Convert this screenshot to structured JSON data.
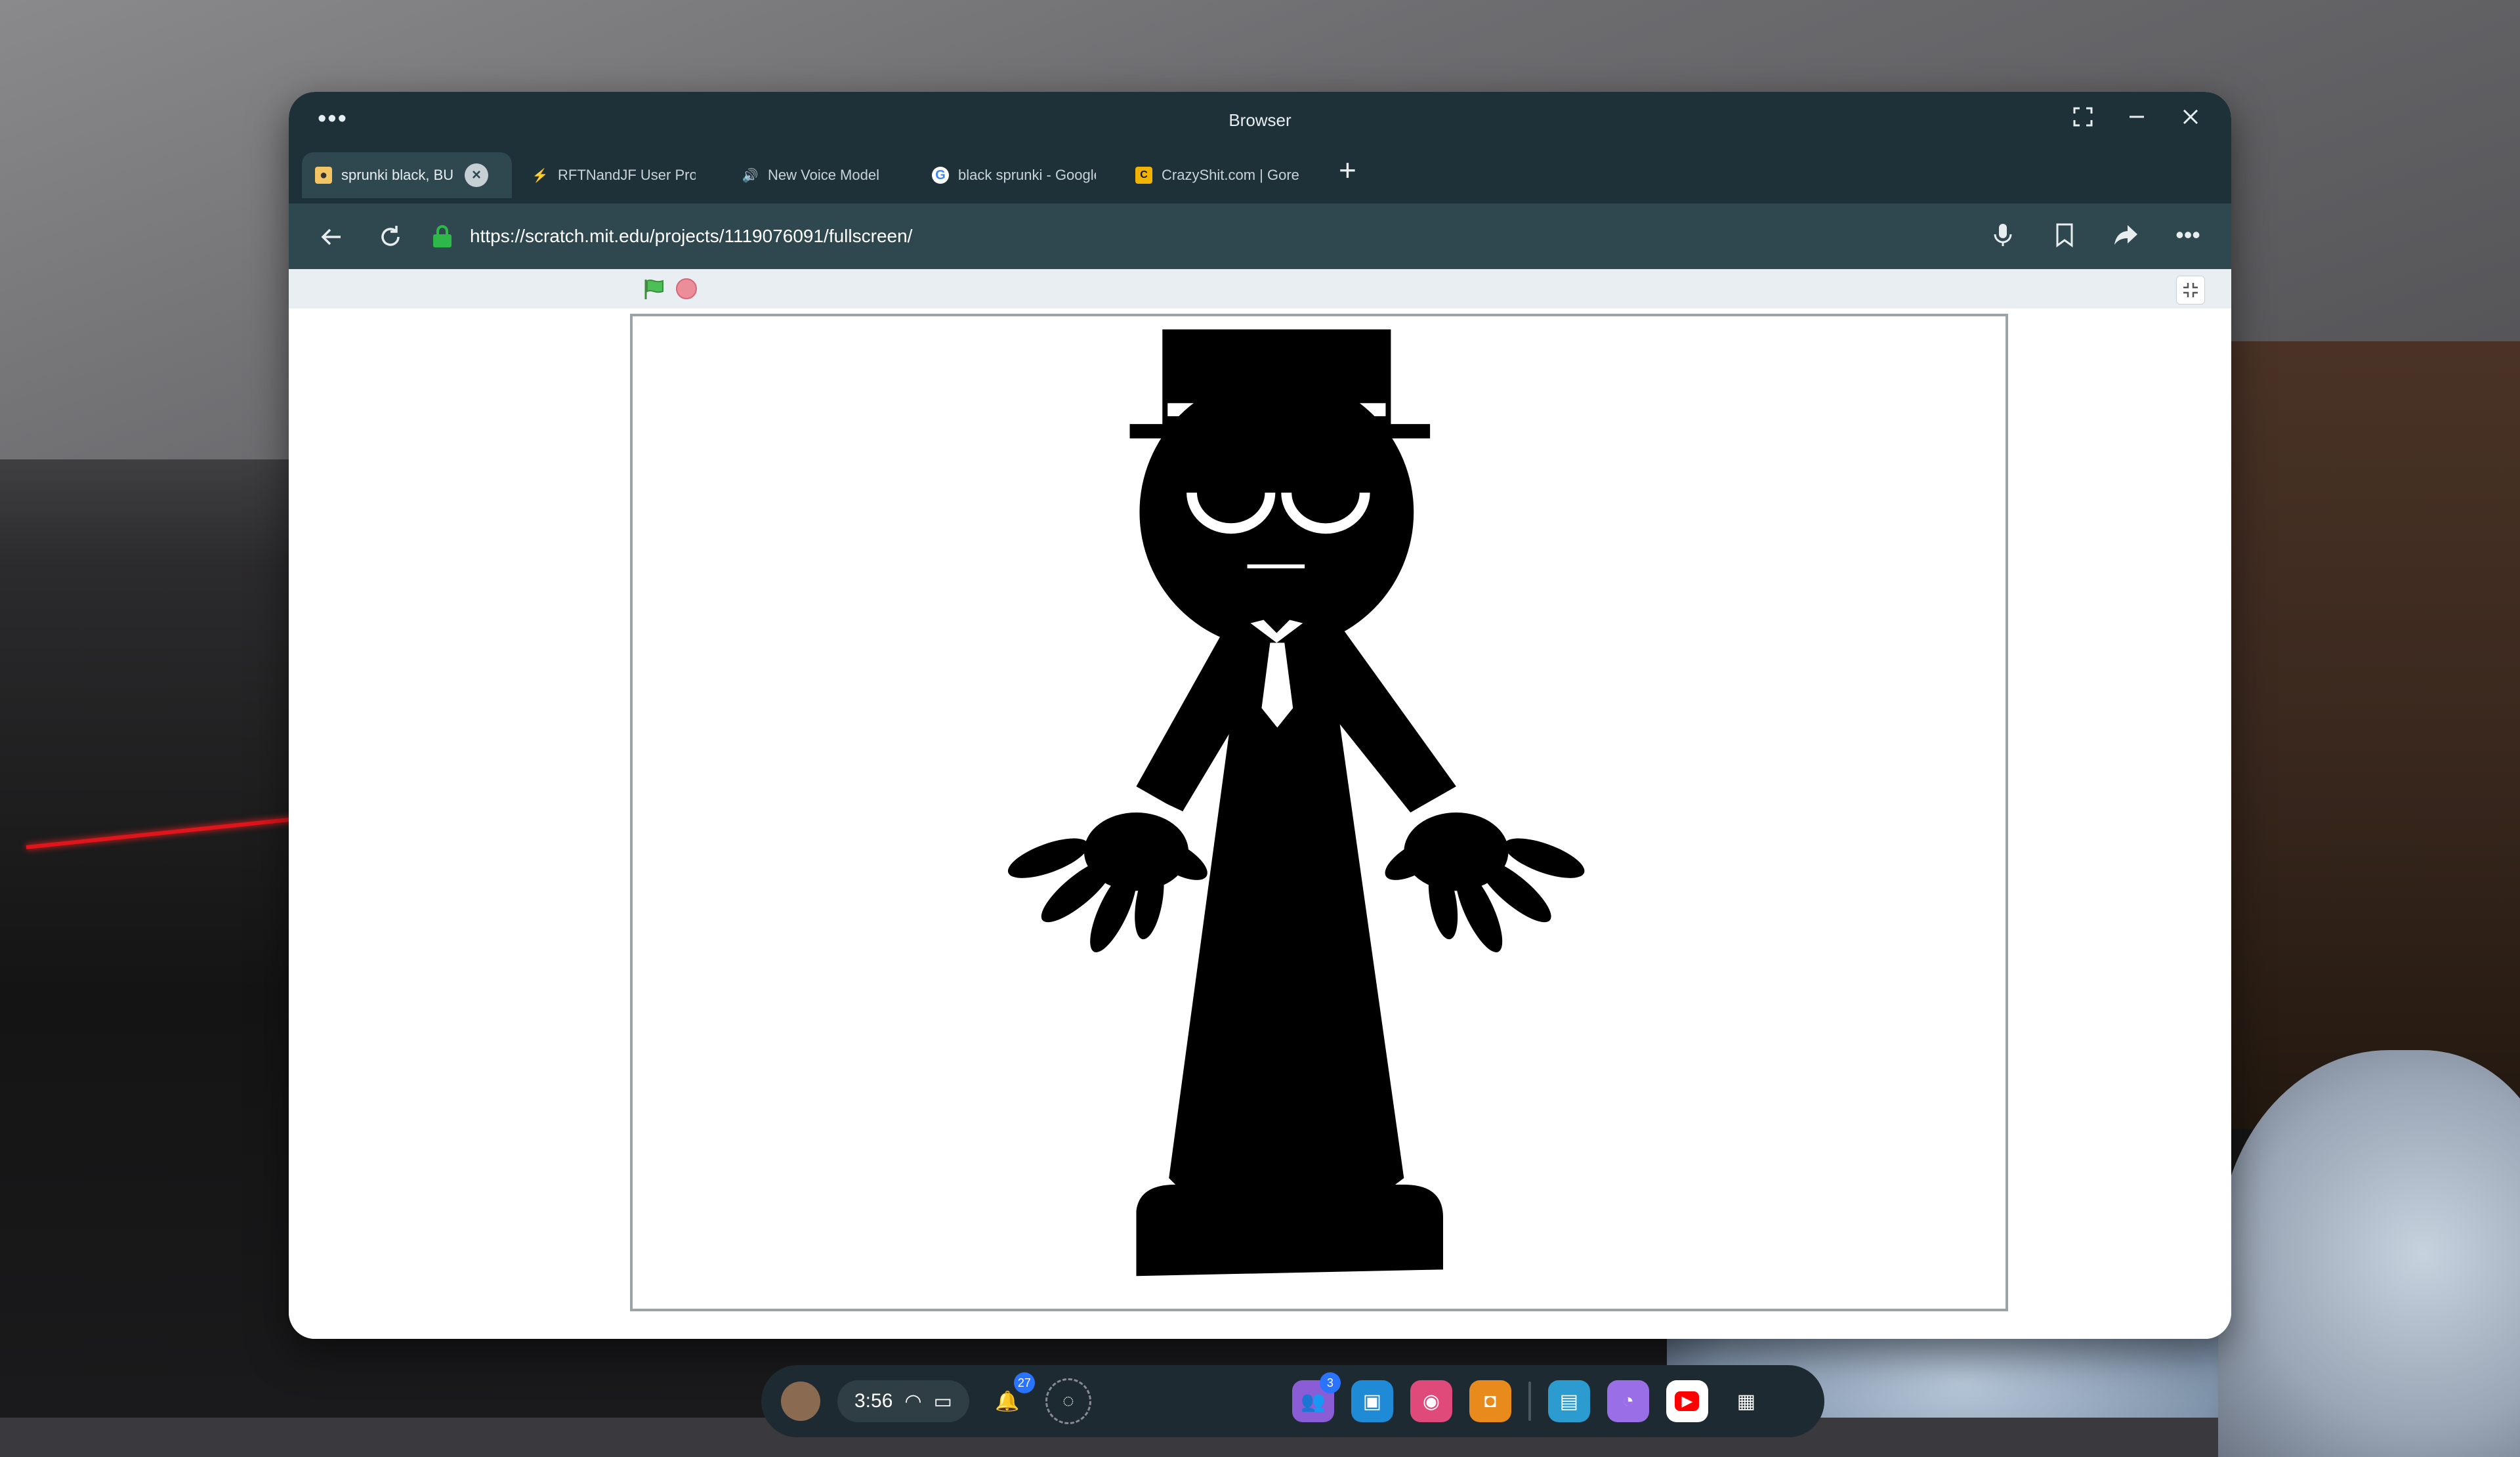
{
  "window": {
    "title": "Browser",
    "menu_glyph": "•••"
  },
  "tabs": [
    {
      "label": "sprunki black, BU",
      "favicon": "scratch-cat-icon",
      "active": true
    },
    {
      "label": "RFTNandJF User Profile",
      "favicon": "rftn-icon",
      "active": false
    },
    {
      "label": "New Voice Model",
      "favicon": "speaker-icon",
      "active": false
    },
    {
      "label": "black sprunki - Google Se",
      "favicon": "google-icon",
      "active": false
    },
    {
      "label": "CrazyShit.com | Gore fet",
      "favicon": "crazyshit-icon",
      "active": false
    }
  ],
  "address": {
    "url": "https://scratch.mit.edu/projects/1119076091/fullscreen/"
  },
  "dock": {
    "time": "3:56",
    "people_badge": "3",
    "notification_badge": "27"
  },
  "colors": {
    "chrome_dark": "#1f3138",
    "chrome_mid": "#2f4850",
    "lock_green": "#2eb84a",
    "flag_green": "#4cbf56",
    "stop_red": "#ec8e9a"
  }
}
